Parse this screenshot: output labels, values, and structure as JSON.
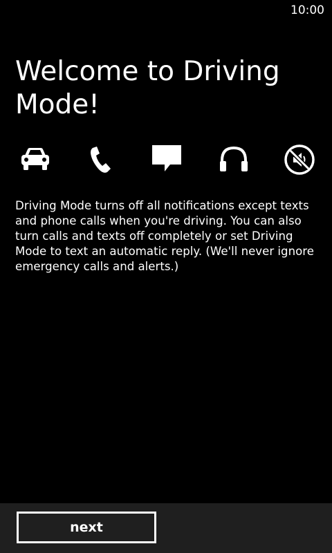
{
  "status_bar": {
    "time": "10:00"
  },
  "page": {
    "title": "Welcome to Driving Mode!",
    "description": "Driving Mode turns off all notifications except texts and phone calls when you're driving. You can also turn calls and texts off completely or set Driving Mode to text an automatic reply. (We'll never ignore emergency calls and alerts.)"
  },
  "icons": [
    {
      "name": "car-icon"
    },
    {
      "name": "phone-icon"
    },
    {
      "name": "message-icon"
    },
    {
      "name": "headphones-icon"
    },
    {
      "name": "mute-icon"
    }
  ],
  "app_bar": {
    "next_label": "next",
    "background": "#1f1f1f"
  },
  "colors": {
    "background": "#000000",
    "foreground": "#ffffff"
  }
}
